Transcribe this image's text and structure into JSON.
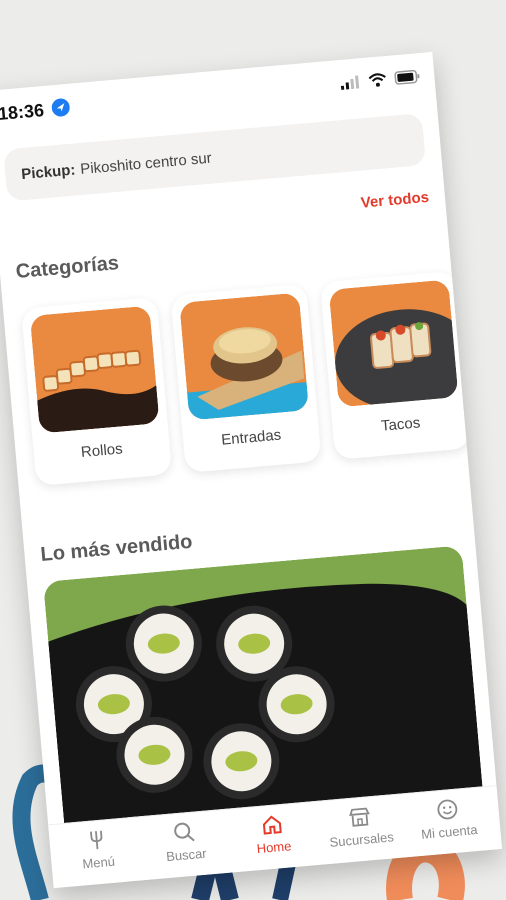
{
  "status": {
    "time": "18:36"
  },
  "pickup": {
    "label": "Pickup:",
    "value": "Pikoshito centro sur"
  },
  "categories": {
    "title": "Categorías",
    "see_all": "Ver todos",
    "items": [
      {
        "label": "Rollos"
      },
      {
        "label": "Entradas"
      },
      {
        "label": "Tacos"
      }
    ]
  },
  "best_sellers": {
    "title": "Lo más vendido"
  },
  "nav": {
    "items": [
      {
        "label": "Menú",
        "icon": "fork-icon"
      },
      {
        "label": "Buscar",
        "icon": "search-icon"
      },
      {
        "label": "Home",
        "icon": "home-icon"
      },
      {
        "label": "Sucursales",
        "icon": "store-icon"
      },
      {
        "label": "Mi cuenta",
        "icon": "smile-icon"
      }
    ],
    "active": "Home"
  },
  "colors": {
    "accent": "#e53a2b",
    "background": "#ececea"
  }
}
